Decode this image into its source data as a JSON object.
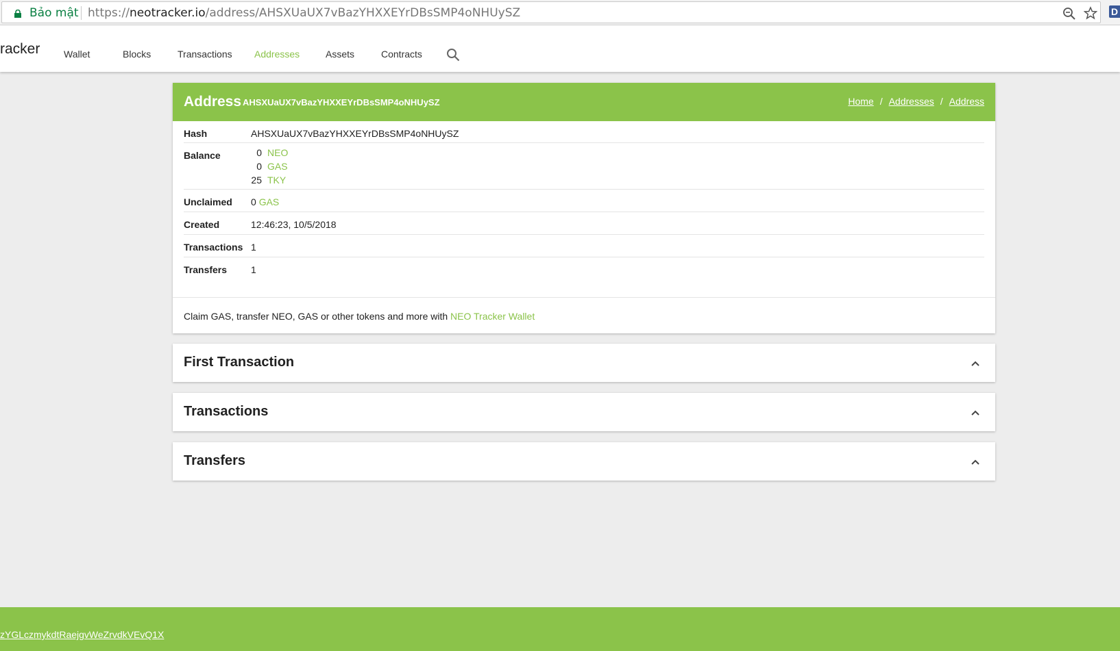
{
  "browser": {
    "secure_label": "Bảo mật",
    "url_scheme": "https://",
    "url_host": "neotracker.io",
    "url_path": "/address/AHSXUaUX7vBazYHXXEYrDBsSMP4oNHUySZ",
    "extension_letter": "D"
  },
  "header": {
    "brand": "racker",
    "nav": [
      "Wallet",
      "Blocks",
      "Transactions",
      "Addresses",
      "Assets",
      "Contracts"
    ],
    "active_nav": "Addresses"
  },
  "address_card": {
    "title": "Address",
    "hash_subtitle": "AHSXUaUX7vBazYHXXEYrDBsSMP4oNHUySZ",
    "breadcrumb": [
      "Home",
      "Addresses",
      "Address"
    ],
    "rows": {
      "hash_label": "Hash",
      "hash_value": "AHSXUaUX7vBazYHXXEYrDBsSMP4oNHUySZ",
      "balance_label": "Balance",
      "balances": [
        {
          "amount": "0",
          "asset": "NEO"
        },
        {
          "amount": "0",
          "asset": "GAS"
        },
        {
          "amount": "25",
          "asset": "TKY"
        }
      ],
      "unclaimed_label": "Unclaimed",
      "unclaimed_amount": "0",
      "unclaimed_asset": "GAS",
      "created_label": "Created",
      "created_value": "12:46:23, 10/5/2018",
      "transactions_label": "Transactions",
      "transactions_value": "1",
      "transfers_label": "Transfers",
      "transfers_value": "1"
    },
    "footer_text": "Claim GAS, transfer NEO, GAS or other tokens and more with ",
    "footer_link": "NEO Tracker Wallet"
  },
  "sections": [
    "First Transaction",
    "Transactions",
    "Transfers"
  ],
  "footer": {
    "link": "zYGLczmykdtRaejgvWeZrvdkVEvQ1X"
  },
  "colors": {
    "accent": "#8bc34a",
    "background": "#ededed"
  },
  "icons": [
    "lock-icon",
    "zoom-out-icon",
    "star-icon",
    "search-icon",
    "chevron-up-icon"
  ]
}
